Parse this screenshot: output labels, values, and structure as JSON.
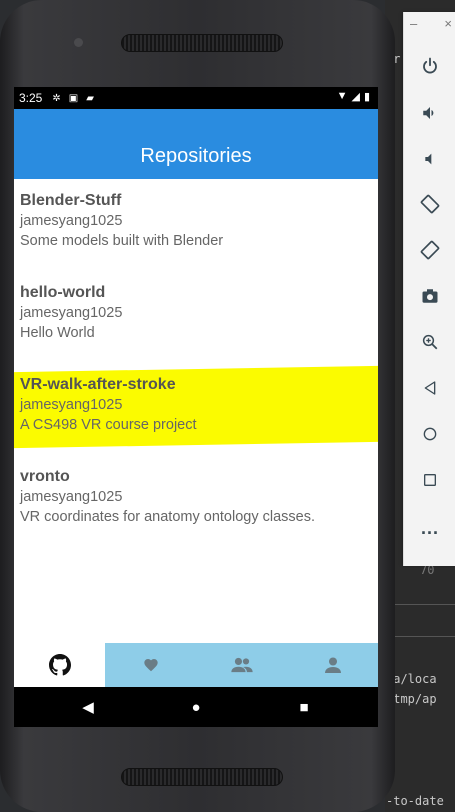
{
  "status_bar": {
    "time": "3:25"
  },
  "app_bar": {
    "title": "Repositories"
  },
  "repos": [
    {
      "name": "Blender-Stuff",
      "owner": "jamesyang1025",
      "description": "Some models built with Blender",
      "highlighted": false
    },
    {
      "name": "hello-world",
      "owner": "jamesyang1025",
      "description": "Hello World",
      "highlighted": false
    },
    {
      "name": "VR-walk-after-stroke",
      "owner": "jamesyang1025",
      "description": "A CS498 VR course project",
      "highlighted": true
    },
    {
      "name": "vronto",
      "owner": "jamesyang1025",
      "description": "VR coordinates for anatomy ontology classes.",
      "highlighted": false
    }
  ],
  "bottom_nav": [
    {
      "icon": "github-icon",
      "active": true
    },
    {
      "icon": "heart-icon",
      "active": false
    },
    {
      "icon": "users-icon",
      "active": false
    },
    {
      "icon": "user-icon",
      "active": false
    }
  ],
  "emulator_panel": {
    "title_minimize": "–",
    "title_close": "×",
    "buttons": [
      "power-icon",
      "volume-up-icon",
      "volume-down-icon",
      "rotate-left-icon",
      "rotate-right-icon",
      "camera-icon",
      "zoom-icon",
      "back-icon",
      "home-icon",
      "overview-icon",
      "more-icon"
    ],
    "more_label": "..."
  },
  "ide_fragments": {
    "top": "er",
    "mid1": "ta/loca",
    "mid2": "/tmp/ap",
    "bottom": "-to-date",
    "num": "70"
  },
  "colors": {
    "app_bar": "#2a8ce0",
    "nav_bg": "#8ecde8",
    "highlight": "#fbfb00"
  }
}
